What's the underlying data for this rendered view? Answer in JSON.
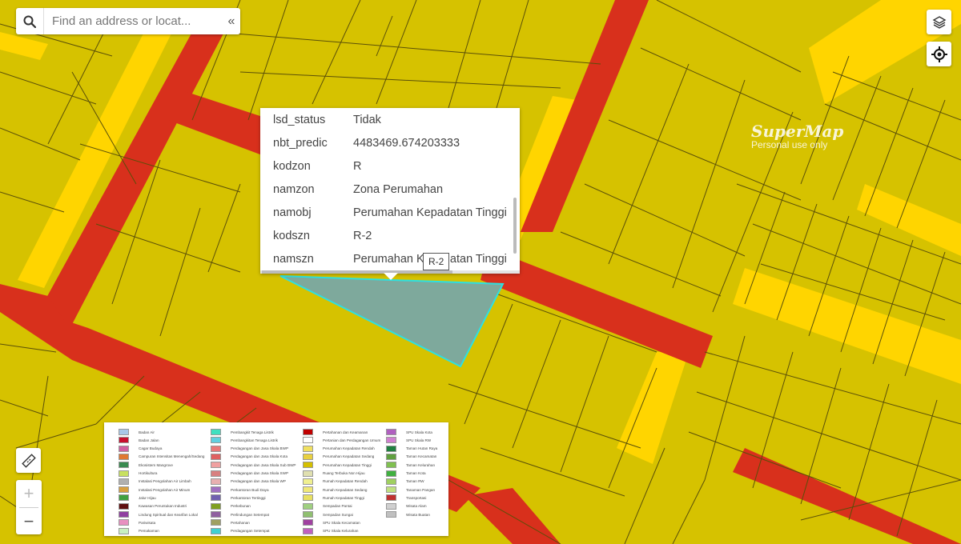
{
  "search": {
    "placeholder": "Find an address or locat...",
    "collapse_glyph": "«"
  },
  "popup": {
    "rows": [
      {
        "key": "lsd_status",
        "value": "Tidak"
      },
      {
        "key": "nbt_predic",
        "value": "4483469.674203333"
      },
      {
        "key": "kodzon",
        "value": "R"
      },
      {
        "key": "namzon",
        "value": "Zona Perumahan"
      },
      {
        "key": "namobj",
        "value": "Perumahan Kepadatan Tinggi"
      },
      {
        "key": "kodszn",
        "value": "R-2"
      },
      {
        "key": "namszn",
        "value": "Perumahan Kepadatan Tinggi"
      }
    ]
  },
  "tooltip": {
    "text": "R-2"
  },
  "watermark": {
    "brand": "SuperMap",
    "subtitle": "Personal use only"
  },
  "zoom": {
    "in": "+",
    "out": "−"
  },
  "colors": {
    "background": "#d4bf00",
    "parcel": "#d6c200",
    "parcel_outline": "#5a4f08",
    "road_red": "#d8301c",
    "road_yellow": "#ffd500",
    "selected_fill": "#7ea99c",
    "selected_outline": "#2de0e0"
  },
  "legend": {
    "columns": [
      [
        {
          "label": "Badan Air",
          "color": "#a8c8e8"
        },
        {
          "label": "Badan Jalan",
          "color": "#c8102e"
        },
        {
          "label": "Cagar Budaya",
          "color": "#d060a0"
        },
        {
          "label": "Campuran Intensitas Menengah/Sedang",
          "color": "#e07830"
        },
        {
          "label": "Ekosistem Mangrove",
          "color": "#3a8a50"
        },
        {
          "label": "Hortikultura",
          "color": "#c8e060"
        },
        {
          "label": "Instalasi Pengolahan Air Limbah",
          "color": "#b0b0b0"
        },
        {
          "label": "Instalasi Pengolahan Air Minum",
          "color": "#d8a040"
        },
        {
          "label": "Jalur Hijau",
          "color": "#40a040"
        },
        {
          "label": "Kawasan Peruntukan Industri",
          "color": "#601010"
        },
        {
          "label": "Lindung Spiritual dan Kearifan Lokal",
          "color": "#9040a0"
        },
        {
          "label": "Pariwisata",
          "color": "#e890c0"
        },
        {
          "label": "Pemakaman",
          "color": "#c8f0c0"
        }
      ],
      [
        {
          "label": "Pembangkit Tenaga Listrik",
          "color": "#40e0c0"
        },
        {
          "label": "Pembangkitan Tenaga Listrik",
          "color": "#60d0e0"
        },
        {
          "label": "Perdagangan dan Jasa Skala BWP",
          "color": "#e87878"
        },
        {
          "label": "Perdagangan dan Jasa Skala Kota",
          "color": "#e06060"
        },
        {
          "label": "Perdagangan dan Jasa Skala Sub BWP",
          "color": "#f0a0a0"
        },
        {
          "label": "Perdagangan dan Jasa Skala SWP",
          "color": "#d88080"
        },
        {
          "label": "Perdagangan dan Jasa Skala WP",
          "color": "#e8b0b0"
        },
        {
          "label": "Perkantoran Budi Daya",
          "color": "#a070c0"
        },
        {
          "label": "Perkantoran Tertinggi",
          "color": "#7060b0"
        },
        {
          "label": "Perkebunan",
          "color": "#80a020"
        },
        {
          "label": "Perlindungan Setempat",
          "color": "#9060a0"
        },
        {
          "label": "Pertahanan",
          "color": "#a0a060"
        },
        {
          "label": "Perdagangan Setempat",
          "color": "#40d0d0"
        }
      ],
      [
        {
          "label": "Pertahanan dan Keamanan",
          "color": "#c00000"
        },
        {
          "label": "Pertanian dan Perdagangan Umum",
          "color": "#ffffff"
        },
        {
          "label": "Perumahan Kepadatan Rendah",
          "color": "#f0e060"
        },
        {
          "label": "Perumahan Kepadatan Sedang",
          "color": "#e8d040"
        },
        {
          "label": "Perumahan Kepadatan Tinggi",
          "color": "#d4bf00"
        },
        {
          "label": "Ruang Terbuka Non Hijau",
          "color": "#e0e0b0"
        },
        {
          "label": "Rumah Kepadatan Rendah",
          "color": "#f0f090"
        },
        {
          "label": "Rumah Kepadatan Sedang",
          "color": "#f0e878"
        },
        {
          "label": "Rumah Kepadatan Tinggi",
          "color": "#e8e060"
        },
        {
          "label": "Sempadan Pantai",
          "color": "#a0d080"
        },
        {
          "label": "Sempadan Sungai",
          "color": "#90c070"
        },
        {
          "label": "SPU Skala Kecamatan",
          "color": "#a040a0"
        },
        {
          "label": "SPU Skala Kelurahan",
          "color": "#c060c0"
        }
      ],
      [
        {
          "label": "SPU Skala Kota",
          "color": "#b060c0"
        },
        {
          "label": "SPU Skala RW",
          "color": "#d080d0"
        },
        {
          "label": "Taman Hutan Raya",
          "color": "#208040"
        },
        {
          "label": "Taman Kecamatan",
          "color": "#60a040"
        },
        {
          "label": "Taman Kelurahan",
          "color": "#80c050"
        },
        {
          "label": "Taman Kota",
          "color": "#40b040"
        },
        {
          "label": "Taman RW",
          "color": "#a0d060"
        },
        {
          "label": "Tanaman Pangan",
          "color": "#c0e080"
        },
        {
          "label": "Transportasi",
          "color": "#c03030"
        },
        {
          "label": "Wisata Alam",
          "color": "#d0d0d0"
        },
        {
          "label": "Wisata Buatan",
          "color": "#c0c0c0"
        }
      ]
    ]
  }
}
